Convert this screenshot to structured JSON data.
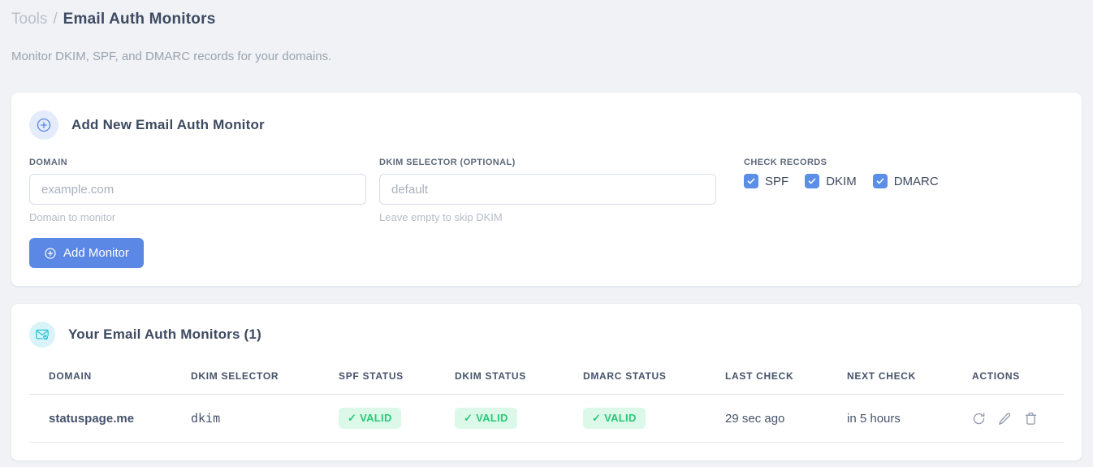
{
  "page": {
    "breadcrumb": {
      "parent": "Tools",
      "separator": "/",
      "current": "Email Auth Monitors"
    },
    "subtitle": "Monitor DKIM, SPF, and DMARC records for your domains."
  },
  "add_monitor_card": {
    "title": "Add New Email Auth Monitor",
    "icon": "circle-plus-icon",
    "fields": {
      "domain": {
        "label": "DOMAIN",
        "value": "",
        "placeholder": "example.com",
        "helper": "Domain to monitor"
      },
      "dkim_selector": {
        "label": "DKIM SELECTOR (OPTIONAL)",
        "value": "",
        "placeholder": "default",
        "helper": "Leave empty to skip DKIM"
      }
    },
    "check_records": {
      "label": "CHECK RECORDS",
      "options": [
        {
          "label": "SPF",
          "checked": true
        },
        {
          "label": "DKIM",
          "checked": true
        },
        {
          "label": "DMARC",
          "checked": true
        }
      ]
    },
    "submit_label": "Add Monitor",
    "submit_icon": "circle-plus-icon"
  },
  "monitors_card": {
    "title": "Your Email Auth Monitors (1)",
    "icon": "envelope-check-icon",
    "table": {
      "columns": [
        "DOMAIN",
        "DKIM SELECTOR",
        "SPF STATUS",
        "DKIM STATUS",
        "DMARC STATUS",
        "LAST CHECK",
        "NEXT CHECK",
        "ACTIONS"
      ],
      "rows": [
        {
          "domain": "statuspage.me",
          "dkim_selector": "dkim",
          "spf_status": "✓ VALID",
          "dkim_status": "✓ VALID",
          "dmarc_status": "✓ VALID",
          "last_check": "29 sec ago",
          "next_check": "in 5 hours",
          "action_icons": [
            "refresh-icon",
            "edit-icon",
            "delete-icon"
          ]
        }
      ]
    }
  },
  "colors": {
    "accent_blue": "#5b87e5",
    "checkbox_blue": "#5b8ee6",
    "icon_badge_blue_bg": "#e4ebfb",
    "teal": "#2bc0d4",
    "icon_badge_teal_bg": "#d9f4f8",
    "valid_badge_bg": "#dcf8e9",
    "valid_badge_text": "#2bc878",
    "selector_pink": "#e8467c",
    "page_background": "#f0f2f5"
  }
}
